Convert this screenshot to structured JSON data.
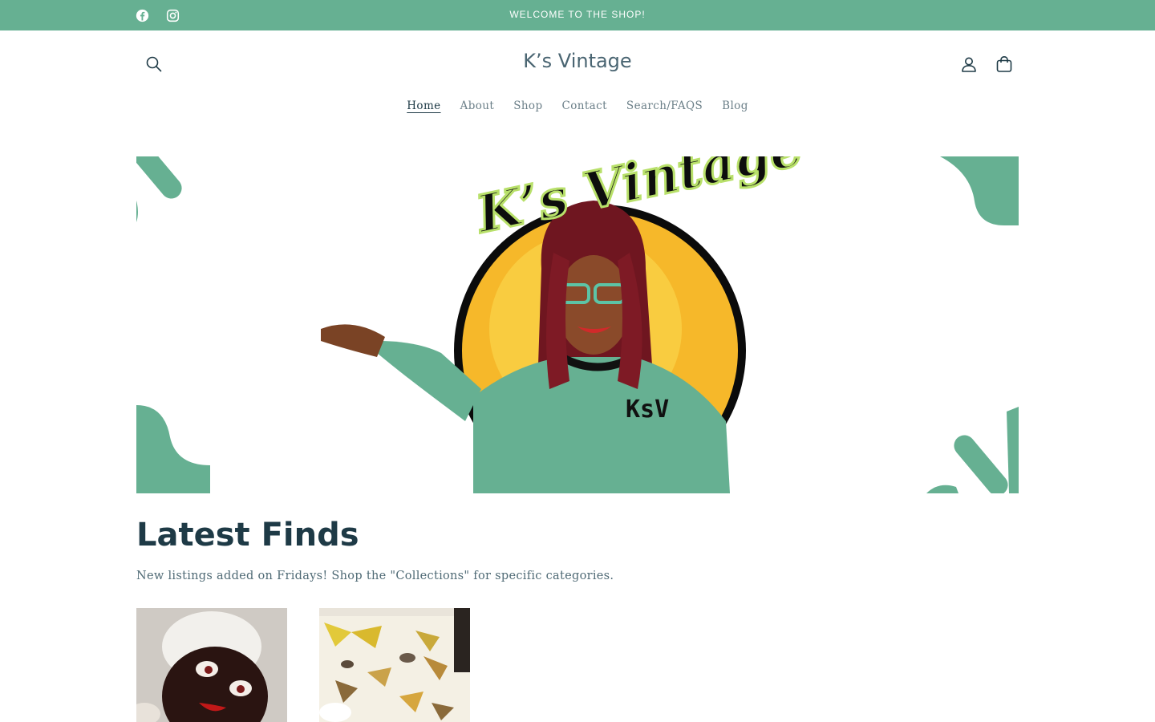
{
  "announcement": {
    "text": "WELCOME TO THE SHOP!",
    "social": [
      "facebook-icon",
      "instagram-icon"
    ]
  },
  "header": {
    "brand": "K’s Vintage",
    "icons": [
      "search-icon",
      "account-icon",
      "cart-icon"
    ]
  },
  "nav": {
    "items": [
      {
        "label": "Home",
        "active": true
      },
      {
        "label": "About"
      },
      {
        "label": "Shop"
      },
      {
        "label": "Contact"
      },
      {
        "label": "Search/FAQS"
      },
      {
        "label": "Blog"
      }
    ]
  },
  "hero": {
    "logo_text": "K’s Vintage",
    "shirt_text": "KsV"
  },
  "latest": {
    "title": "Latest Finds",
    "description": "New listings added on Fridays! Shop the \"Collections\" for specific categories."
  },
  "colors": {
    "accent": "#66b092",
    "heading": "#1e3a46",
    "text": "#4f6a75"
  }
}
